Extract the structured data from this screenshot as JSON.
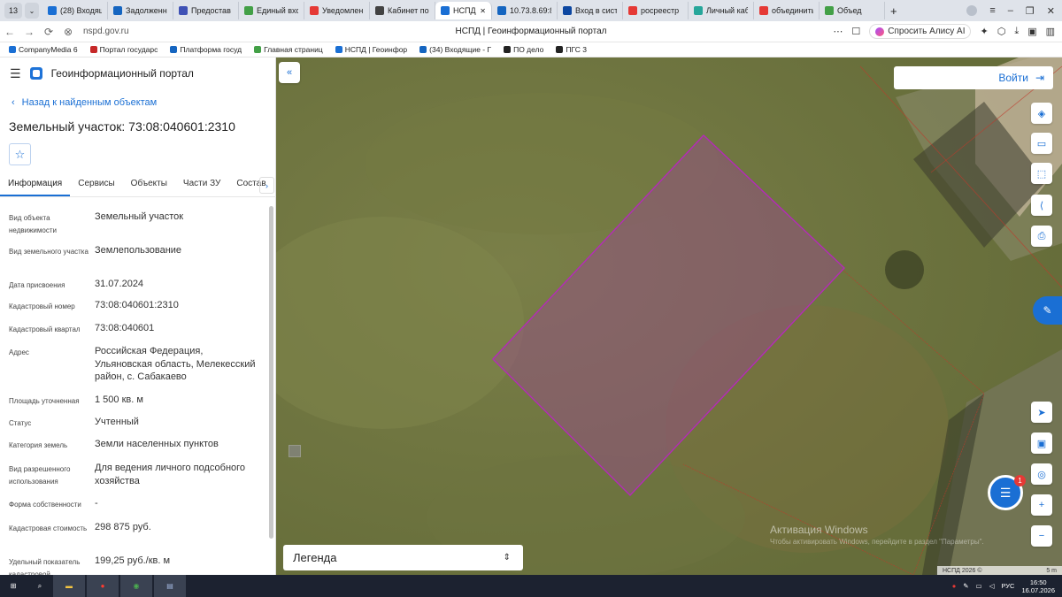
{
  "browser": {
    "tab_count": "13",
    "tabs": [
      {
        "label": "(28) Входящ",
        "color": "#1a6fd4",
        "active": false
      },
      {
        "label": "Задолженно",
        "color": "#1565c0",
        "active": false
      },
      {
        "label": "Предостав",
        "color": "#3f51b5",
        "active": false
      },
      {
        "label": "Единый вход",
        "color": "#43a047",
        "active": false
      },
      {
        "label": "Уведомлен",
        "color": "#e53935",
        "active": false
      },
      {
        "label": "Кабинет по",
        "color": "#424242",
        "active": false
      },
      {
        "label": "НСПД | Г",
        "color": "#1a6fd4",
        "active": true
      },
      {
        "label": "10.73.8.69:8",
        "color": "#1565c0",
        "active": false
      },
      {
        "label": "Вход в систе",
        "color": "#0d47a1",
        "active": false
      },
      {
        "label": "росреестр",
        "color": "#e53935",
        "active": false
      },
      {
        "label": "Личный каб",
        "color": "#26a69a",
        "active": false
      },
      {
        "label": "объединить",
        "color": "#e53935",
        "active": false
      },
      {
        "label": "Объед",
        "color": "#43a047",
        "active": false
      }
    ],
    "url": "nspd.gov.ru",
    "page_title": "НСПД | Геоинформационный портал",
    "alisa_label": "Спросить Алису AI",
    "bookmarks": [
      "CompanyMedia 6",
      "Портал государс",
      "Платформа госуд",
      "Главная страниц",
      "НСПД | Геоинфор",
      "(34) Входящие - Г",
      "ПО дело",
      "ПГС 3"
    ]
  },
  "app": {
    "portal_name": "Геоинформационный портал",
    "back_link": "Назад к найденным объектам",
    "object_title": "Земельный участок: 73:08:040601:2310",
    "tabs": [
      "Информация",
      "Сервисы",
      "Объекты",
      "Части ЗУ",
      "Состав"
    ],
    "info": [
      {
        "label": "Вид объекта недвижимости",
        "value": "Земельный участок"
      },
      {
        "label": "Вид земельного участка",
        "value": "Землепользование"
      },
      {
        "label": "Дата присвоения",
        "value": "31.07.2024"
      },
      {
        "label": "Кадастровый номер",
        "value": "73:08:040601:2310"
      },
      {
        "label": "Кадастровый квартал",
        "value": "73:08:040601"
      },
      {
        "label": "Адрес",
        "value": "Российская Федерация, Ульяновская область, Мелекесский район, с. Сабакаево"
      },
      {
        "label": "Площадь уточненная",
        "value": "1 500 кв. м"
      },
      {
        "label": "Статус",
        "value": "Учтенный"
      },
      {
        "label": "Категория земель",
        "value": "Земли населенных пунктов"
      },
      {
        "label": "Вид разрешенного использования",
        "value": "Для ведения личного подсобного хозяйства"
      },
      {
        "label": "Форма собственности",
        "value": "-"
      },
      {
        "label": "Кадастровая стоимость",
        "value": "298 875 руб."
      },
      {
        "label": "Удельный показатель кадастровой",
        "value": "199,25 руб./кв. м"
      }
    ]
  },
  "map": {
    "login_label": "Войти",
    "legend_label": "Легенда",
    "chat_badge": "1",
    "watermark_title": "Активация Windows",
    "watermark_text": "Чтобы активировать Windows, перейдите в раздел \"Параметры\".",
    "copyright": "НСПД 2026 ©",
    "scale_label": "5 m",
    "parcel_fill": "#9a4a8e",
    "parcel_stroke": "#b42bb8"
  },
  "taskbar": {
    "lang": "РУС",
    "time": "16:50",
    "date": "16.07.2026"
  }
}
